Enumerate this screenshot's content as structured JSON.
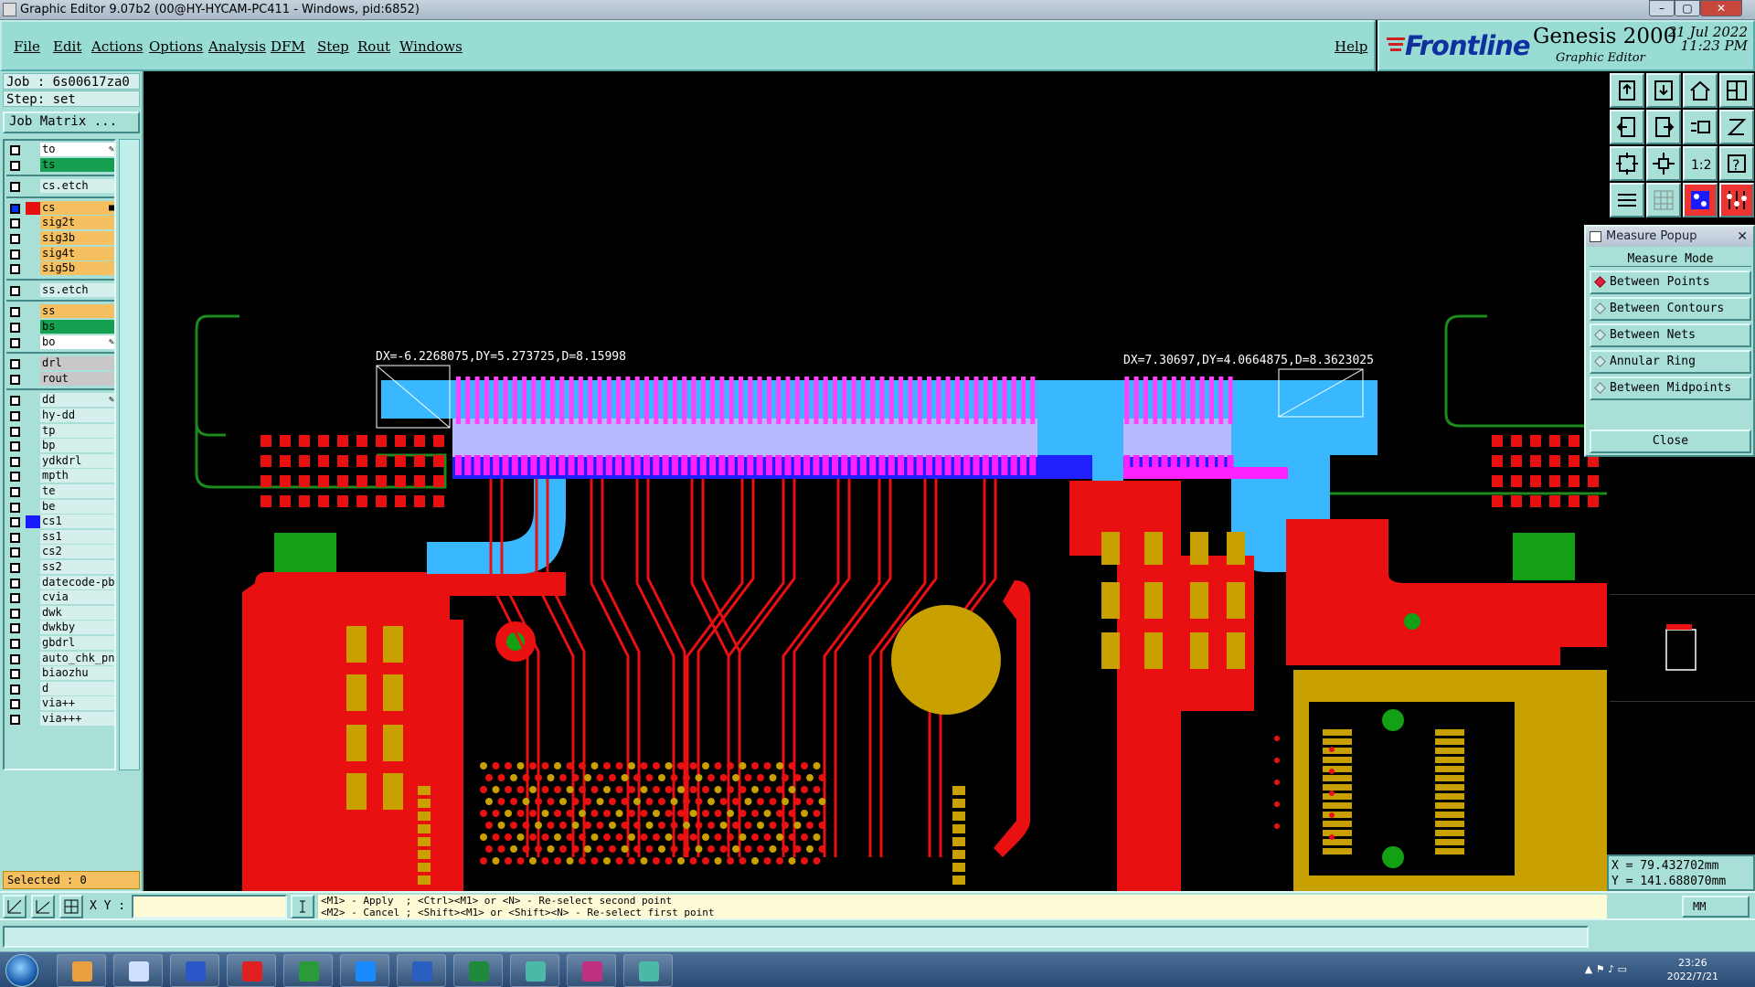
{
  "window": {
    "title": "Graphic Editor 9.07b2 (00@HY-HYCAM-PC411 - Windows, pid:6852)"
  },
  "menu": {
    "items": [
      "File",
      "Edit",
      "Actions",
      "Options",
      "Analysis",
      "DFM",
      "Step",
      "Rout",
      "Windows"
    ],
    "help": "Help"
  },
  "brand": {
    "company": "Frontline",
    "product": "Genesis 2000",
    "subtitle": "Graphic Editor",
    "date": "21 Jul 2022",
    "time": "11:23 PM"
  },
  "job": {
    "job_line": "Job : 6s00617za0",
    "step_line": "Step: set",
    "matrix_button": "Job Matrix ..."
  },
  "layers": [
    {
      "name": "to",
      "color": "#ffffff",
      "checked": false,
      "mark": "✎"
    },
    {
      "name": "ts",
      "color": "#14a050",
      "checked": false
    },
    {
      "name": "cs.etch",
      "color": "#d4efec",
      "checked": false
    },
    {
      "name": "cs",
      "color": "#f6c060",
      "checked": true,
      "swatch": "#e61010",
      "mark": "■"
    },
    {
      "name": "sig2t",
      "color": "#f6c060",
      "checked": false
    },
    {
      "name": "sig3b",
      "color": "#f6c060",
      "checked": false
    },
    {
      "name": "sig4t",
      "color": "#f6c060",
      "checked": false
    },
    {
      "name": "sig5b",
      "color": "#f6c060",
      "checked": false
    },
    {
      "name": "ss.etch",
      "color": "#d4efec",
      "checked": false
    },
    {
      "name": "ss",
      "color": "#f6c060",
      "checked": false
    },
    {
      "name": "bs",
      "color": "#14a050",
      "checked": false
    },
    {
      "name": "bo",
      "color": "#ffffff",
      "checked": false,
      "mark": "✎"
    },
    {
      "name": "drl",
      "color": "#c8c8c8",
      "checked": false
    },
    {
      "name": "rout",
      "color": "#c8c8c8",
      "checked": false
    },
    {
      "name": "dd",
      "color": "#d4efec",
      "checked": false,
      "mark": "✎"
    },
    {
      "name": "hy-dd",
      "color": "#d4efec",
      "checked": false
    },
    {
      "name": "tp",
      "color": "#d4efec",
      "checked": false
    },
    {
      "name": "bp",
      "color": "#d4efec",
      "checked": false
    },
    {
      "name": "ydkdrl",
      "color": "#d4efec",
      "checked": false
    },
    {
      "name": "mpth",
      "color": "#d4efec",
      "checked": false
    },
    {
      "name": "te",
      "color": "#d4efec",
      "checked": false
    },
    {
      "name": "be",
      "color": "#d4efec",
      "checked": false
    },
    {
      "name": "cs1",
      "color": "#d4efec",
      "checked": false,
      "swatch": "#1a1aff"
    },
    {
      "name": "ss1",
      "color": "#d4efec",
      "checked": false
    },
    {
      "name": "cs2",
      "color": "#d4efec",
      "checked": false
    },
    {
      "name": "ss2",
      "color": "#d4efec",
      "checked": false
    },
    {
      "name": "datecode-pbo",
      "color": "#d4efec",
      "checked": false
    },
    {
      "name": "cvia",
      "color": "#d4efec",
      "checked": false
    },
    {
      "name": "dwk",
      "color": "#d4efec",
      "checked": false
    },
    {
      "name": "dwkby",
      "color": "#d4efec",
      "checked": false
    },
    {
      "name": "gbdrl",
      "color": "#d4efec",
      "checked": false
    },
    {
      "name": "auto_chk_pn",
      "color": "#d4efec",
      "checked": false
    },
    {
      "name": "biaozhu",
      "color": "#d4efec",
      "checked": false
    },
    {
      "name": "d",
      "color": "#d4efec",
      "checked": false
    },
    {
      "name": "via++",
      "color": "#d4efec",
      "checked": false
    },
    {
      "name": "via+++",
      "color": "#d4efec",
      "checked": false
    }
  ],
  "selected": "Selected : 0",
  "measurements": {
    "left": "DX=-6.2268075,DY=5.273725,D=8.15998",
    "right": "DX=7.30697,DY=4.0664875,D=8.3623025"
  },
  "measure_popup": {
    "title": "Measure Popup",
    "header": "Measure Mode",
    "options": [
      {
        "label": "Between Points",
        "selected": true
      },
      {
        "label": "Between Contours",
        "selected": false
      },
      {
        "label": "Between Nets",
        "selected": false
      },
      {
        "label": "Annular Ring",
        "selected": false
      },
      {
        "label": "Between Midpoints",
        "selected": false
      }
    ],
    "close": "Close"
  },
  "toolbar_icons": [
    "open-step-icon",
    "save-icon",
    "home-icon",
    "layout-icon",
    "pan-left-icon",
    "pan-right-icon",
    "display-icon",
    "snap-icon",
    "zoom-fit-icon",
    "zoom-home-icon",
    "zoom-1to2-icon",
    "help-icon",
    "profile-icon",
    "grid-icon",
    "layer-red-icon",
    "layer-red-icon-2"
  ],
  "coords": {
    "x": "X = 79.432702mm",
    "y": "Y = 141.688070mm"
  },
  "bottom": {
    "xy_label": "X Y :",
    "xy_value": "",
    "hint_line1": "<M1> - Apply  ; <Ctrl><M1> or <N> - Re-select second point",
    "hint_line2": "<M2> - Cancel ; <Shift><M1> or <Shift><N> - Re-select first point",
    "units": "MM"
  },
  "taskbar": {
    "time": "23:26",
    "date": "2022/7/21"
  }
}
